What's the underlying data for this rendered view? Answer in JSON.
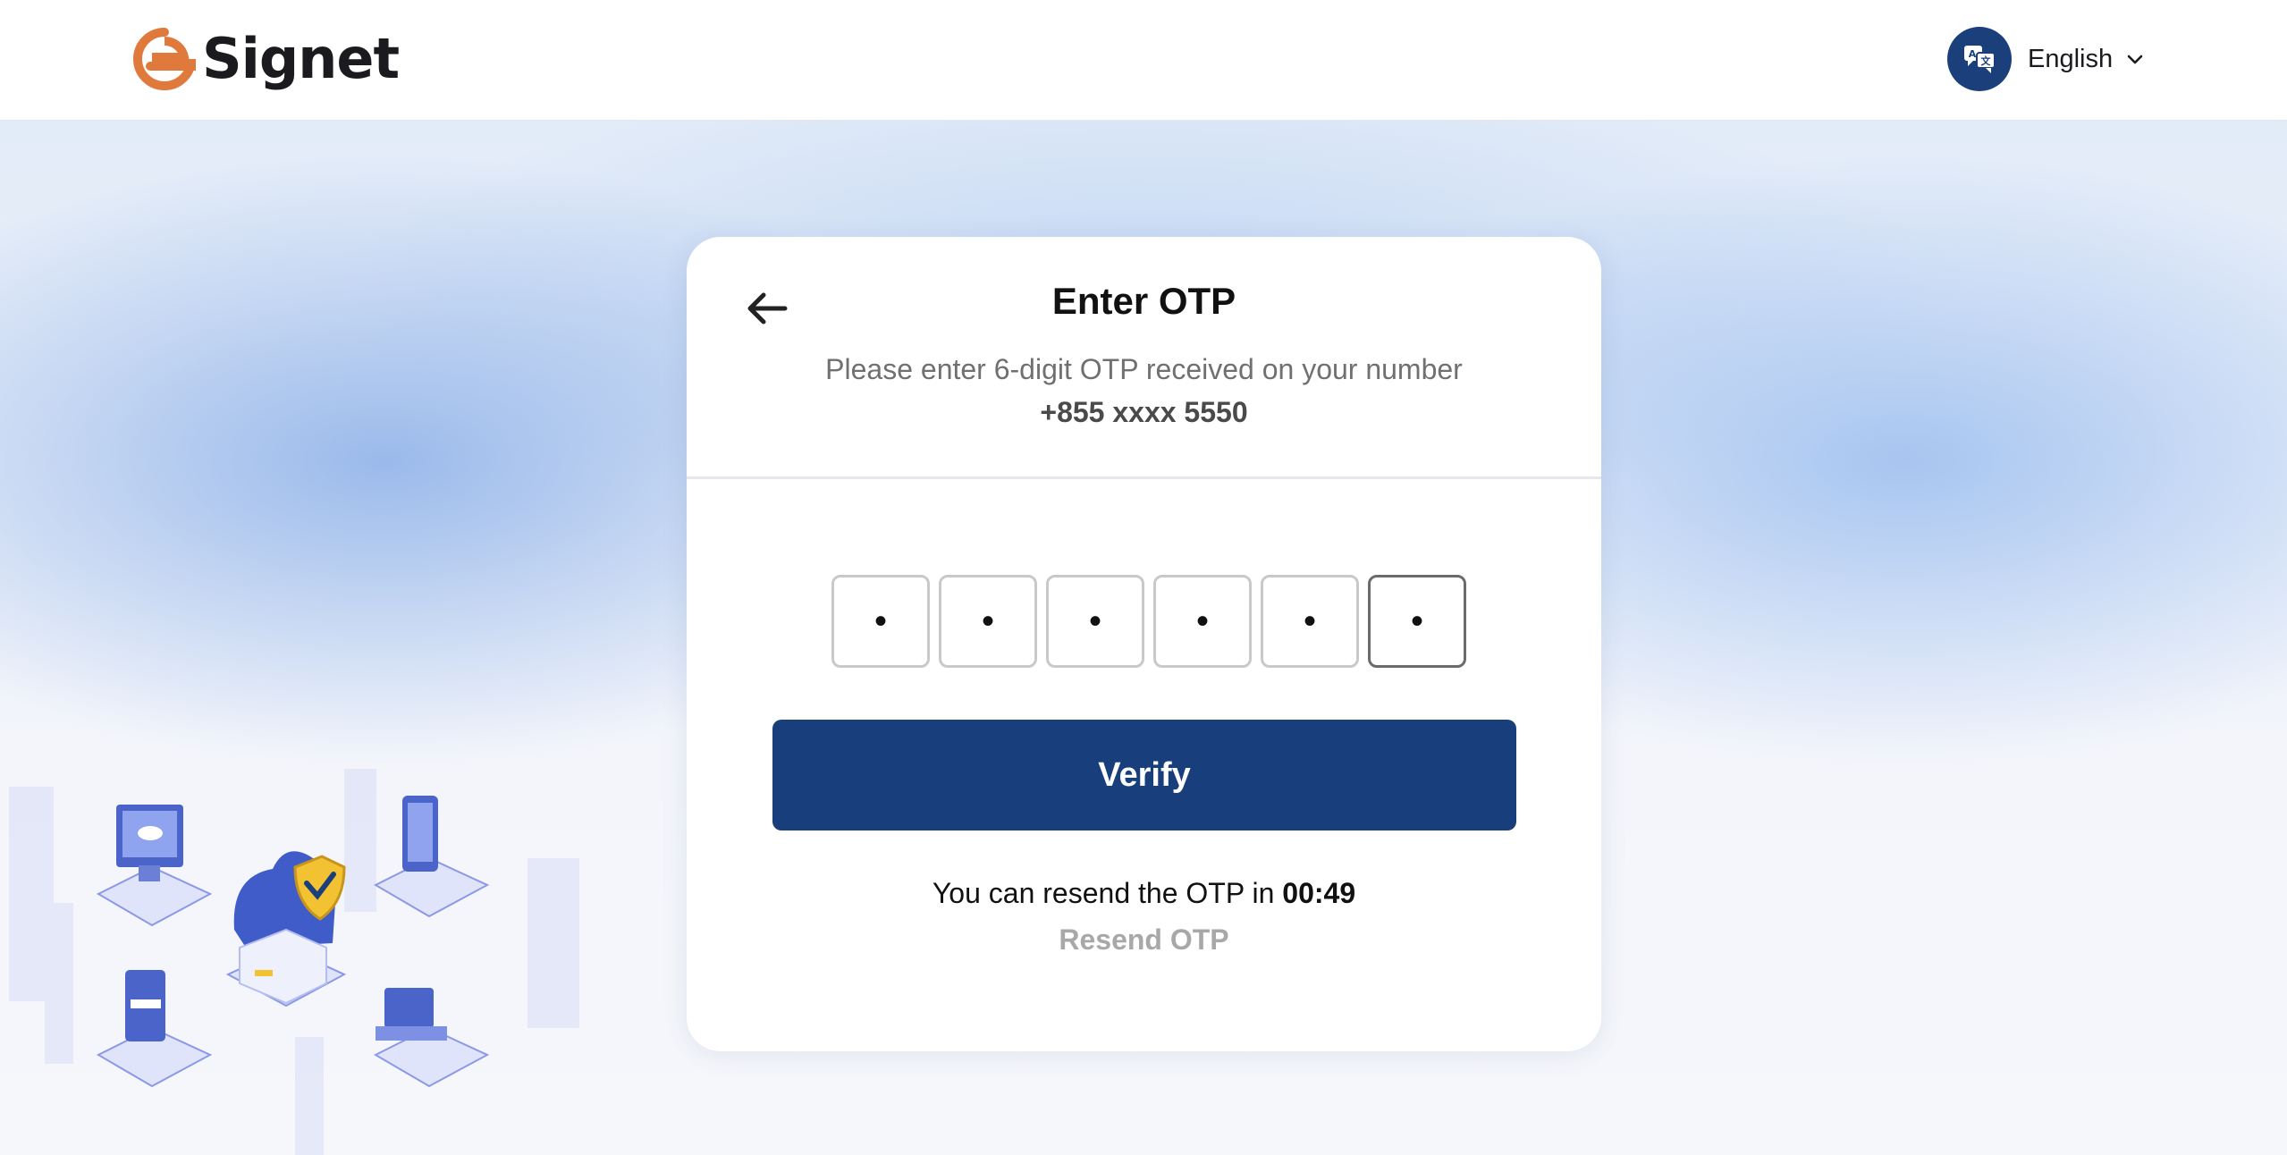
{
  "brand": {
    "name": "Signet",
    "accent": "#e07a3c"
  },
  "header": {
    "language": "English",
    "language_icon": "translate-icon"
  },
  "card": {
    "title": "Enter OTP",
    "subtitle": "Please enter 6-digit OTP received on your number",
    "phone": "+855 xxxx 5550",
    "otp_digits": [
      "•",
      "•",
      "•",
      "•",
      "•",
      "•"
    ],
    "verify_label": "Verify",
    "resend_prefix": "You can resend the OTP in",
    "resend_timer": "00:49",
    "resend_link": "Resend OTP"
  },
  "colors": {
    "primary": "#183f7c",
    "muted": "#a8a8a8"
  }
}
